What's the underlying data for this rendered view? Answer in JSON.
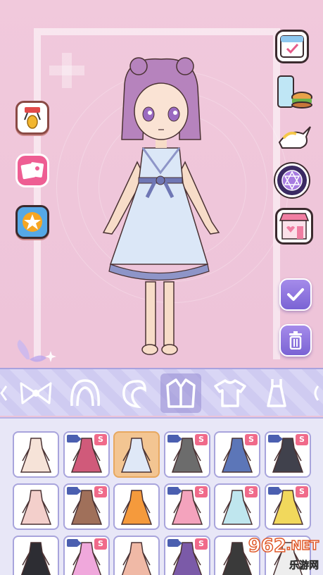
{
  "left_buttons": [
    {
      "name": "gacha-machine",
      "icon": "claw-machine-icon"
    },
    {
      "name": "photo-album",
      "icon": "photos-icon"
    },
    {
      "name": "achievements",
      "icon": "star-badge-icon"
    }
  ],
  "right_buttons": [
    {
      "name": "calendar-checkin",
      "icon": "calendar-check-icon"
    },
    {
      "name": "food-shop",
      "icon": "burger-drink-icon"
    },
    {
      "name": "unicorn-pet",
      "icon": "unicorn-icon"
    },
    {
      "name": "magic-circle",
      "icon": "hexagram-icon"
    },
    {
      "name": "store",
      "icon": "shop-icon"
    }
  ],
  "actions": {
    "confirm_icon": "checkmark-icon",
    "delete_icon": "trash-icon"
  },
  "categories": [
    {
      "name": "bow",
      "icon": "bow-icon"
    },
    {
      "name": "hair-front",
      "icon": "hair-front-icon"
    },
    {
      "name": "hair-back",
      "icon": "hair-back-icon"
    },
    {
      "name": "coat",
      "icon": "coat-icon",
      "selected": true
    },
    {
      "name": "shirt",
      "icon": "shirt-icon"
    },
    {
      "name": "dress",
      "icon": "dress-icon"
    }
  ],
  "items_badge_label": "S",
  "items": [
    {
      "color": "#f6e3d8",
      "video": false,
      "paid": false
    },
    {
      "color": "#d05a7a",
      "video": true,
      "paid": true
    },
    {
      "color": "#dfe8f7",
      "video": false,
      "paid": false,
      "selected": true
    },
    {
      "color": "#6c6c6c",
      "video": true,
      "paid": true
    },
    {
      "color": "#5c76b8",
      "video": false,
      "paid": true
    },
    {
      "color": "#40414c",
      "video": true,
      "paid": true
    },
    {
      "color": "#f3cfcb",
      "video": false,
      "paid": false
    },
    {
      "color": "#a0705a",
      "video": true,
      "paid": true
    },
    {
      "color": "#f59a3c",
      "video": false,
      "paid": false
    },
    {
      "color": "#f4a3bd",
      "video": true,
      "paid": true
    },
    {
      "color": "#bfe6ee",
      "video": false,
      "paid": true
    },
    {
      "color": "#f1d85c",
      "video": true,
      "paid": true
    },
    {
      "color": "#2d2d33",
      "video": false,
      "paid": false
    },
    {
      "color": "#f0a8dc",
      "video": true,
      "paid": true
    },
    {
      "color": "#f0b9a6",
      "video": false,
      "paid": false
    },
    {
      "color": "#7b5aa8",
      "video": true,
      "paid": true
    },
    {
      "color": "#3a3a3a",
      "video": false,
      "paid": false
    },
    {
      "color": "#eeeeee",
      "video": false,
      "paid": false
    }
  ],
  "watermark": {
    "number": "962",
    "suffix": ".NET",
    "sub": "乐游网"
  }
}
